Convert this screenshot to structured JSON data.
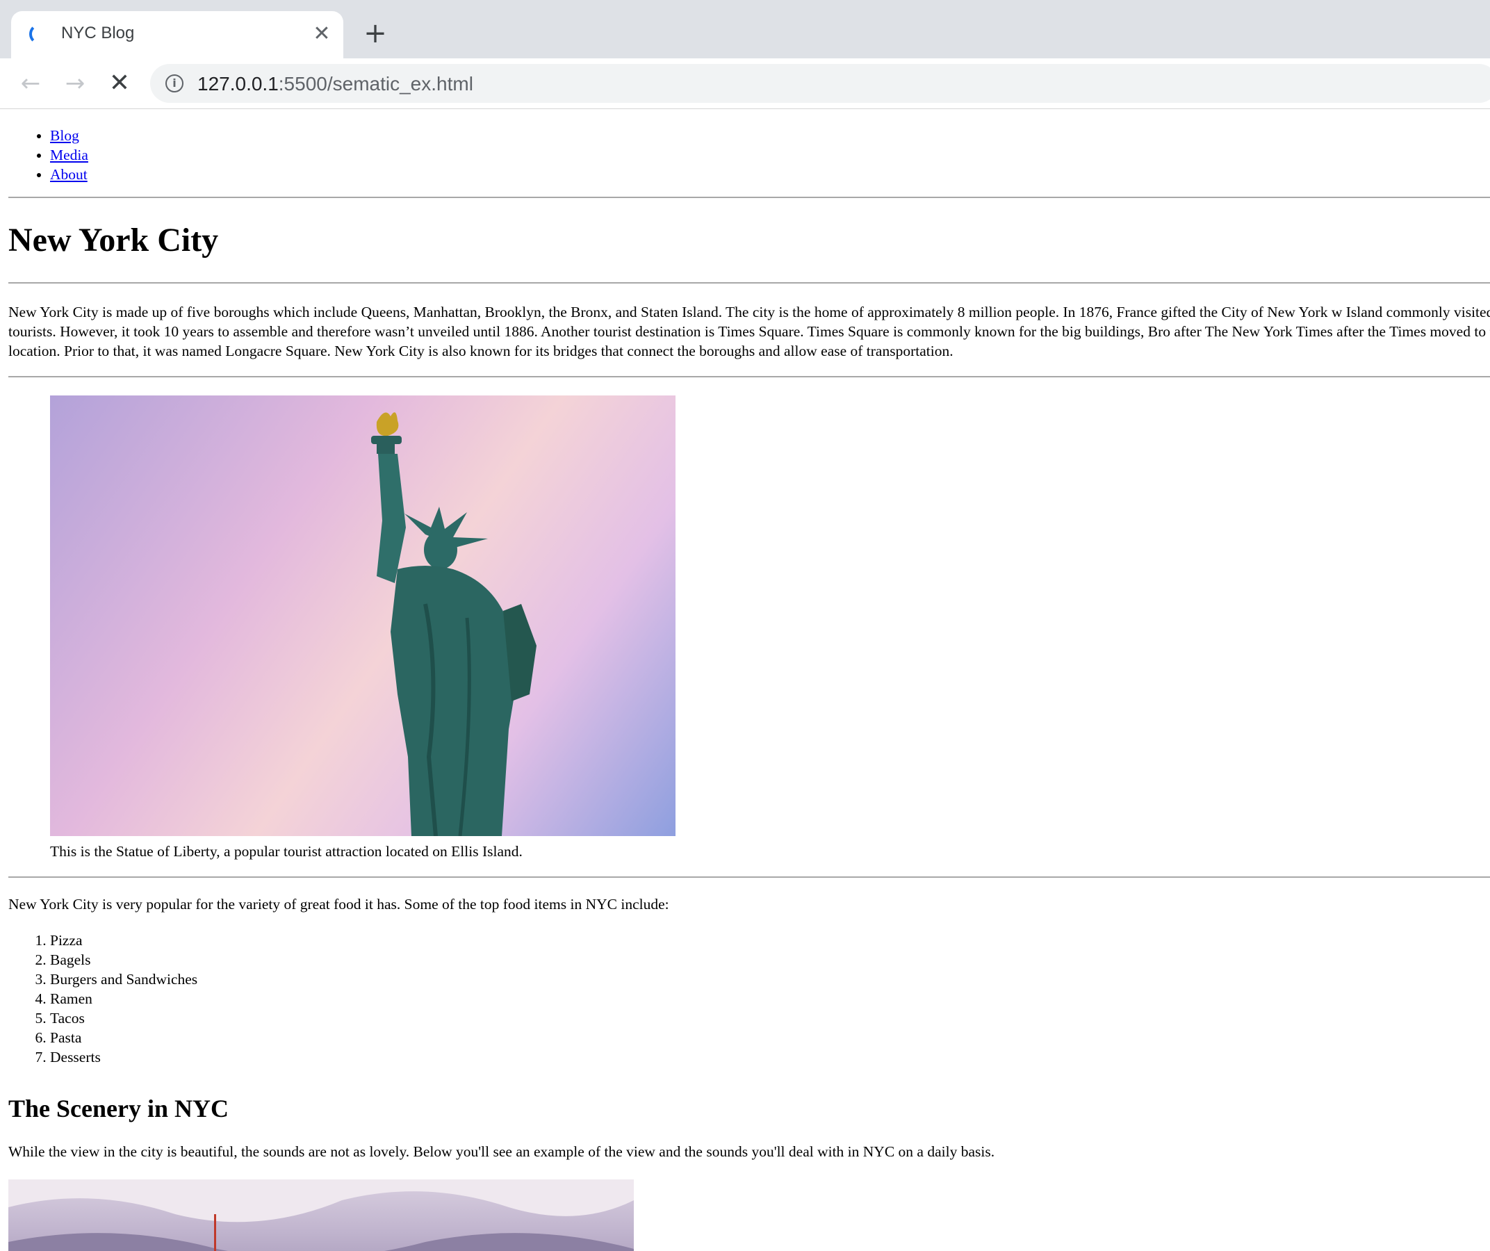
{
  "browser": {
    "tab_title": "NYC Blog",
    "tab_close_icon": "close-icon",
    "new_tab_icon": "plus-icon",
    "back_icon": "arrow-left-icon",
    "forward_icon": "arrow-right-icon",
    "stop_icon": "stop-loading-icon",
    "url_host": "127.0.0.1",
    "url_rest": ":5500/sematic_ex.html"
  },
  "nav": {
    "items": [
      {
        "label": "Blog"
      },
      {
        "label": "Media"
      },
      {
        "label": "About"
      }
    ]
  },
  "article": {
    "title": "New York City",
    "intro": "New York City is made up of five boroughs which include Queens, Manhattan, Brooklyn, the Bronx, and Staten Island. The city is the home of approximately 8 million people. In 1876, France gifted the City of New York w Island commonly visited by tourists. However, it took 10 years to assemble and therefore wasn’t unveiled until 1886. Another tourist destination is Times Square. Times Square is commonly known for the big buildings, Bro after The New York Times after the Times moved to that location. Prior to that, it was named Longacre Square. New York City is also known for its bridges that connect the boroughs and allow ease of transportation.",
    "figure_caption": "This is the Statue of Liberty, a popular tourist attraction located on Ellis Island.",
    "food_intro": "New York City is very popular for the variety of great food it has. Some of the top food items in NYC include:",
    "food_items": [
      "Pizza",
      "Bagels",
      "Burgers and Sandwiches",
      "Ramen",
      "Tacos",
      "Pasta",
      "Desserts"
    ],
    "scenery_heading": "The Scenery in NYC",
    "scenery_text": "While the view in the city is beautiful, the sounds are not as lovely. Below you'll see an example of the view and the sounds you'll deal with in NYC on a daily basis."
  }
}
